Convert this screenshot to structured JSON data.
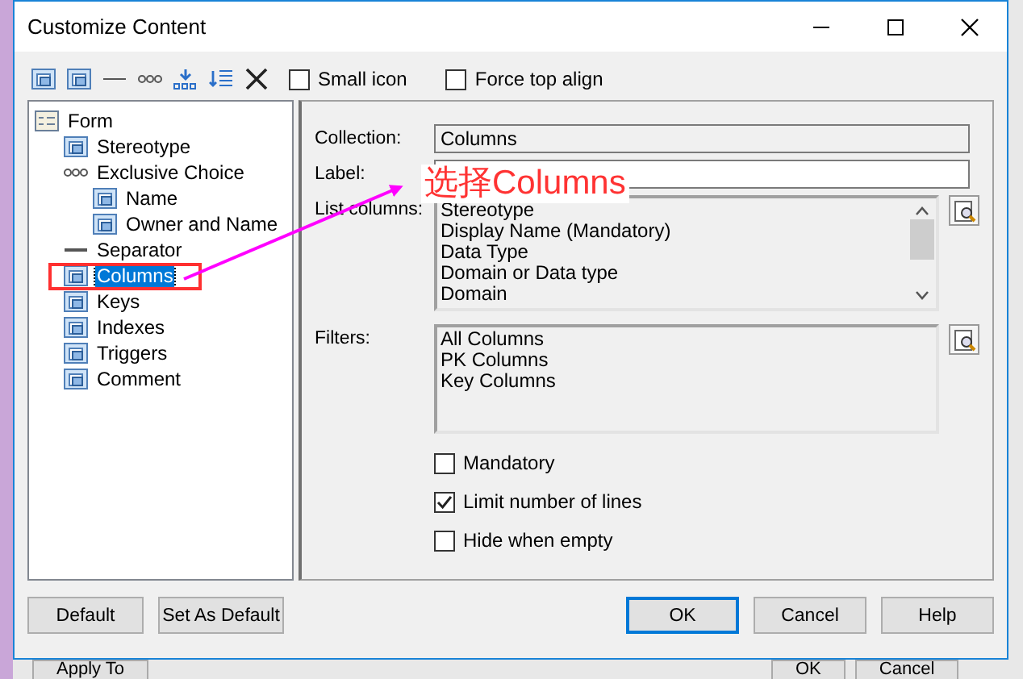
{
  "window": {
    "title": "Customize Content"
  },
  "toolbar": {
    "checkboxes": [
      {
        "label": "Small icon",
        "checked": false
      },
      {
        "label": "Force top align",
        "checked": false
      }
    ]
  },
  "tree": {
    "items": [
      {
        "label": "Form",
        "kind": "form",
        "selected": false,
        "children": [
          {
            "label": "Stereotype",
            "kind": "group",
            "selected": false
          },
          {
            "label": "Exclusive Choice",
            "kind": "choice",
            "selected": false,
            "children": [
              {
                "label": "Name",
                "kind": "group",
                "selected": false
              },
              {
                "label": "Owner and Name",
                "kind": "group",
                "selected": false
              }
            ]
          },
          {
            "label": "Separator",
            "kind": "separator",
            "selected": false
          },
          {
            "label": "Columns",
            "kind": "group",
            "selected": true
          },
          {
            "label": "Keys",
            "kind": "group",
            "selected": false
          },
          {
            "label": "Indexes",
            "kind": "group",
            "selected": false
          },
          {
            "label": "Triggers",
            "kind": "group",
            "selected": false
          },
          {
            "label": "Comment",
            "kind": "group",
            "selected": false
          }
        ]
      }
    ]
  },
  "properties": {
    "collection": {
      "label": "Collection:",
      "value": "Columns"
    },
    "label_field": {
      "label": "Label:"
    },
    "list_columns": {
      "label": "List columns:",
      "items": [
        "Stereotype",
        "Display Name (Mandatory)",
        "Data Type",
        "Domain or Data type",
        "Domain"
      ]
    },
    "filters": {
      "label": "Filters:",
      "items": [
        "All Columns",
        "PK Columns",
        "Key Columns"
      ]
    },
    "checkboxes": [
      {
        "label": "Mandatory",
        "checked": false
      },
      {
        "label": "Limit number of lines",
        "checked": true
      },
      {
        "label": "Hide when empty",
        "checked": false
      }
    ]
  },
  "buttons": {
    "left": [
      "Default",
      "Set As Default"
    ],
    "right": [
      {
        "label": "OK",
        "default": true
      },
      {
        "label": "Cancel",
        "default": false
      },
      {
        "label": "Help",
        "default": false
      }
    ]
  },
  "background_buttons": [
    "Apply To",
    "OK",
    "Cancel"
  ],
  "annotation": {
    "text": "选择Columns"
  }
}
